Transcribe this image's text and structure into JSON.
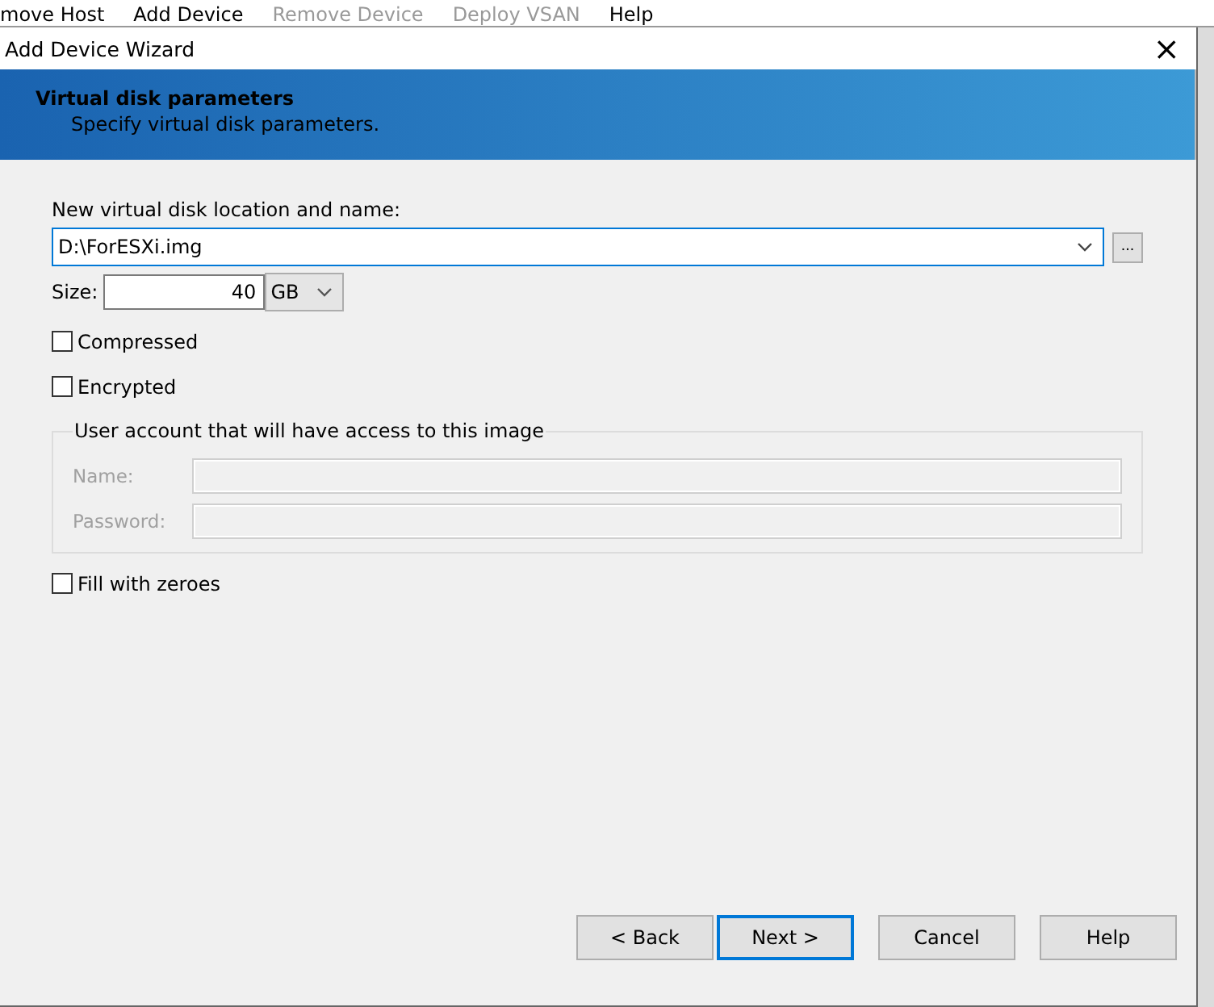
{
  "background_toolbar": [
    {
      "label": "move Host",
      "disabled": false
    },
    {
      "label": "Add Device",
      "disabled": false
    },
    {
      "label": "Remove Device",
      "disabled": true
    },
    {
      "label": "Deploy VSAN",
      "disabled": true
    },
    {
      "label": "Help",
      "disabled": false
    }
  ],
  "window": {
    "title": "Add Device Wizard",
    "close": "×"
  },
  "header": {
    "title": "Virtual disk parameters",
    "subtitle": "Specify virtual disk parameters."
  },
  "location": {
    "label": "New virtual disk location and name:",
    "value": "D:\\ForESXi.img",
    "browse": "..."
  },
  "size": {
    "label": "Size:",
    "value": "40",
    "unit": "GB"
  },
  "options": [
    {
      "label": "Compressed",
      "checked": false
    },
    {
      "label": "Encrypted",
      "checked": false
    }
  ],
  "account": {
    "title": "User account that will have access to this image",
    "disabled": true,
    "fields": [
      {
        "label": "Name:"
      },
      {
        "label": "Password:"
      }
    ]
  },
  "fill_zeroes": {
    "label": "Fill with zeroes",
    "checked": false
  },
  "buttons": [
    {
      "label": "< Back",
      "selected": false
    },
    {
      "label": "Next >",
      "selected": true
    },
    {
      "label": "Cancel",
      "selected": false
    },
    {
      "label": "Help",
      "selected": false
    }
  ]
}
